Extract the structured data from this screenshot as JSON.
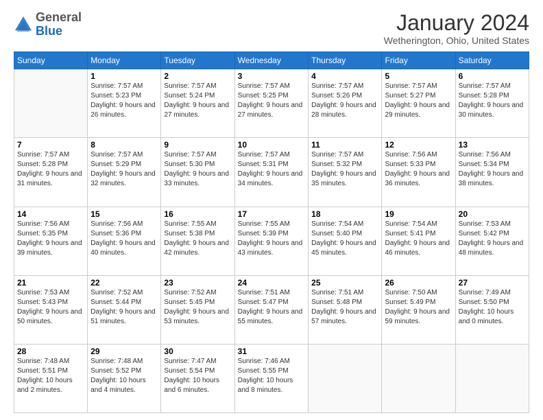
{
  "logo": {
    "general": "General",
    "blue": "Blue"
  },
  "header": {
    "title": "January 2024",
    "location": "Wetherington, Ohio, United States"
  },
  "days_of_week": [
    "Sunday",
    "Monday",
    "Tuesday",
    "Wednesday",
    "Thursday",
    "Friday",
    "Saturday"
  ],
  "weeks": [
    [
      {
        "day": "",
        "sunrise": "",
        "sunset": "",
        "daylight": ""
      },
      {
        "day": "1",
        "sunrise": "Sunrise: 7:57 AM",
        "sunset": "Sunset: 5:23 PM",
        "daylight": "Daylight: 9 hours and 26 minutes."
      },
      {
        "day": "2",
        "sunrise": "Sunrise: 7:57 AM",
        "sunset": "Sunset: 5:24 PM",
        "daylight": "Daylight: 9 hours and 27 minutes."
      },
      {
        "day": "3",
        "sunrise": "Sunrise: 7:57 AM",
        "sunset": "Sunset: 5:25 PM",
        "daylight": "Daylight: 9 hours and 27 minutes."
      },
      {
        "day": "4",
        "sunrise": "Sunrise: 7:57 AM",
        "sunset": "Sunset: 5:26 PM",
        "daylight": "Daylight: 9 hours and 28 minutes."
      },
      {
        "day": "5",
        "sunrise": "Sunrise: 7:57 AM",
        "sunset": "Sunset: 5:27 PM",
        "daylight": "Daylight: 9 hours and 29 minutes."
      },
      {
        "day": "6",
        "sunrise": "Sunrise: 7:57 AM",
        "sunset": "Sunset: 5:28 PM",
        "daylight": "Daylight: 9 hours and 30 minutes."
      }
    ],
    [
      {
        "day": "7",
        "sunrise": "Sunrise: 7:57 AM",
        "sunset": "Sunset: 5:28 PM",
        "daylight": "Daylight: 9 hours and 31 minutes."
      },
      {
        "day": "8",
        "sunrise": "Sunrise: 7:57 AM",
        "sunset": "Sunset: 5:29 PM",
        "daylight": "Daylight: 9 hours and 32 minutes."
      },
      {
        "day": "9",
        "sunrise": "Sunrise: 7:57 AM",
        "sunset": "Sunset: 5:30 PM",
        "daylight": "Daylight: 9 hours and 33 minutes."
      },
      {
        "day": "10",
        "sunrise": "Sunrise: 7:57 AM",
        "sunset": "Sunset: 5:31 PM",
        "daylight": "Daylight: 9 hours and 34 minutes."
      },
      {
        "day": "11",
        "sunrise": "Sunrise: 7:57 AM",
        "sunset": "Sunset: 5:32 PM",
        "daylight": "Daylight: 9 hours and 35 minutes."
      },
      {
        "day": "12",
        "sunrise": "Sunrise: 7:56 AM",
        "sunset": "Sunset: 5:33 PM",
        "daylight": "Daylight: 9 hours and 36 minutes."
      },
      {
        "day": "13",
        "sunrise": "Sunrise: 7:56 AM",
        "sunset": "Sunset: 5:34 PM",
        "daylight": "Daylight: 9 hours and 38 minutes."
      }
    ],
    [
      {
        "day": "14",
        "sunrise": "Sunrise: 7:56 AM",
        "sunset": "Sunset: 5:35 PM",
        "daylight": "Daylight: 9 hours and 39 minutes."
      },
      {
        "day": "15",
        "sunrise": "Sunrise: 7:56 AM",
        "sunset": "Sunset: 5:36 PM",
        "daylight": "Daylight: 9 hours and 40 minutes."
      },
      {
        "day": "16",
        "sunrise": "Sunrise: 7:55 AM",
        "sunset": "Sunset: 5:38 PM",
        "daylight": "Daylight: 9 hours and 42 minutes."
      },
      {
        "day": "17",
        "sunrise": "Sunrise: 7:55 AM",
        "sunset": "Sunset: 5:39 PM",
        "daylight": "Daylight: 9 hours and 43 minutes."
      },
      {
        "day": "18",
        "sunrise": "Sunrise: 7:54 AM",
        "sunset": "Sunset: 5:40 PM",
        "daylight": "Daylight: 9 hours and 45 minutes."
      },
      {
        "day": "19",
        "sunrise": "Sunrise: 7:54 AM",
        "sunset": "Sunset: 5:41 PM",
        "daylight": "Daylight: 9 hours and 46 minutes."
      },
      {
        "day": "20",
        "sunrise": "Sunrise: 7:53 AM",
        "sunset": "Sunset: 5:42 PM",
        "daylight": "Daylight: 9 hours and 48 minutes."
      }
    ],
    [
      {
        "day": "21",
        "sunrise": "Sunrise: 7:53 AM",
        "sunset": "Sunset: 5:43 PM",
        "daylight": "Daylight: 9 hours and 50 minutes."
      },
      {
        "day": "22",
        "sunrise": "Sunrise: 7:52 AM",
        "sunset": "Sunset: 5:44 PM",
        "daylight": "Daylight: 9 hours and 51 minutes."
      },
      {
        "day": "23",
        "sunrise": "Sunrise: 7:52 AM",
        "sunset": "Sunset: 5:45 PM",
        "daylight": "Daylight: 9 hours and 53 minutes."
      },
      {
        "day": "24",
        "sunrise": "Sunrise: 7:51 AM",
        "sunset": "Sunset: 5:47 PM",
        "daylight": "Daylight: 9 hours and 55 minutes."
      },
      {
        "day": "25",
        "sunrise": "Sunrise: 7:51 AM",
        "sunset": "Sunset: 5:48 PM",
        "daylight": "Daylight: 9 hours and 57 minutes."
      },
      {
        "day": "26",
        "sunrise": "Sunrise: 7:50 AM",
        "sunset": "Sunset: 5:49 PM",
        "daylight": "Daylight: 9 hours and 59 minutes."
      },
      {
        "day": "27",
        "sunrise": "Sunrise: 7:49 AM",
        "sunset": "Sunset: 5:50 PM",
        "daylight": "Daylight: 10 hours and 0 minutes."
      }
    ],
    [
      {
        "day": "28",
        "sunrise": "Sunrise: 7:48 AM",
        "sunset": "Sunset: 5:51 PM",
        "daylight": "Daylight: 10 hours and 2 minutes."
      },
      {
        "day": "29",
        "sunrise": "Sunrise: 7:48 AM",
        "sunset": "Sunset: 5:52 PM",
        "daylight": "Daylight: 10 hours and 4 minutes."
      },
      {
        "day": "30",
        "sunrise": "Sunrise: 7:47 AM",
        "sunset": "Sunset: 5:54 PM",
        "daylight": "Daylight: 10 hours and 6 minutes."
      },
      {
        "day": "31",
        "sunrise": "Sunrise: 7:46 AM",
        "sunset": "Sunset: 5:55 PM",
        "daylight": "Daylight: 10 hours and 8 minutes."
      },
      {
        "day": "",
        "sunrise": "",
        "sunset": "",
        "daylight": ""
      },
      {
        "day": "",
        "sunrise": "",
        "sunset": "",
        "daylight": ""
      },
      {
        "day": "",
        "sunrise": "",
        "sunset": "",
        "daylight": ""
      }
    ]
  ]
}
